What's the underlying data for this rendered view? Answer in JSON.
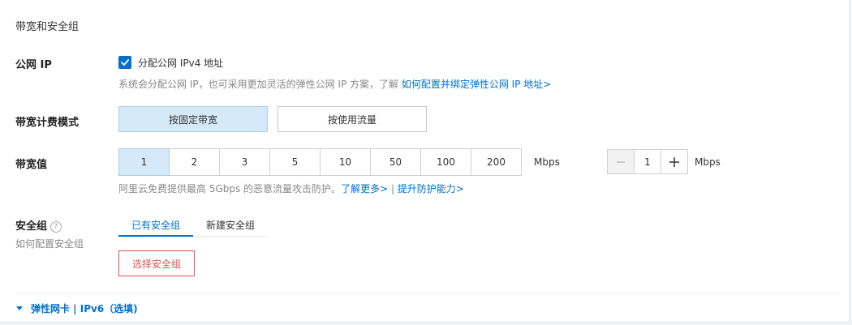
{
  "section_title": "带宽和安全组",
  "public_ip": {
    "label": "公网 IP",
    "checkbox_label": "分配公网 IPv4 地址",
    "checked": true,
    "help_text": "系统会分配公网 IP，也可采用更加灵活的弹性公网 IP 方案，了解 ",
    "help_link": "如何配置并绑定弹性公网 IP 地址>"
  },
  "billing": {
    "label": "带宽计费模式",
    "options": [
      "按固定带宽",
      "按使用流量"
    ],
    "selected": "按固定带宽"
  },
  "bandwidth": {
    "label": "带宽值",
    "options": [
      "1",
      "2",
      "3",
      "5",
      "10",
      "50",
      "100",
      "200"
    ],
    "selected": "1",
    "unit": "Mbps",
    "stepper_value": "1",
    "stepper_unit": "Mbps",
    "help_text": "阿里云免费提供最高 5Gbps 的恶意流量攻击防护。",
    "help_link1": "了解更多>",
    "help_sep": " | ",
    "help_link2": "提升防护能力>"
  },
  "security_group": {
    "label": "安全组",
    "sub_label": "如何配置安全组",
    "tabs": [
      "已有安全组",
      "新建安全组"
    ],
    "active_tab": "已有安全组",
    "select_button": "选择安全组",
    "help_icon_glyph": "?"
  },
  "footer": {
    "label": "弹性网卡 | IPv6（选填)"
  },
  "colors": {
    "accent": "#0070cc",
    "selected_bg": "#d6e9f8",
    "danger": "#d9534f"
  }
}
